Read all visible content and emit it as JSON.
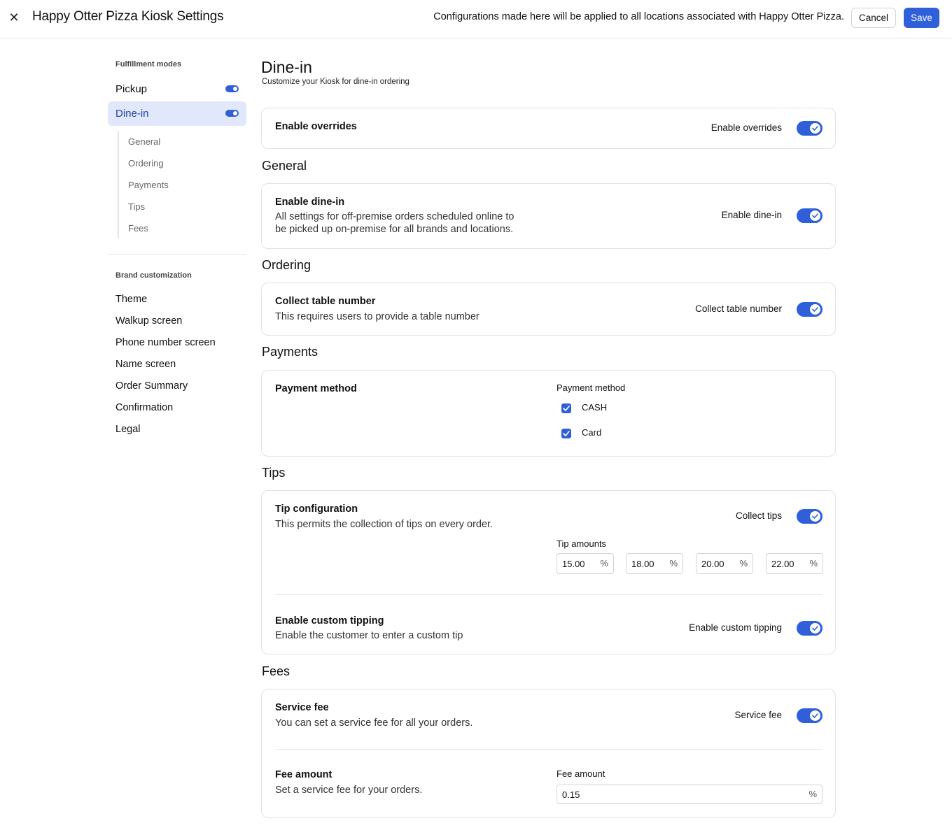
{
  "header": {
    "close_icon": "close-icon",
    "title": "Happy Otter Pizza Kiosk Settings",
    "note": "Configurations made here will be applied to all locations associated with Happy Otter Pizza.",
    "cancel_label": "Cancel",
    "save_label": "Save"
  },
  "sidebar": {
    "fulfillment_label": "Fulfillment modes",
    "modes": [
      {
        "label": "Pickup",
        "enabled": true
      },
      {
        "label": "Dine-in",
        "enabled": true,
        "active": true
      }
    ],
    "sub_items": [
      "General",
      "Ordering",
      "Payments",
      "Tips",
      "Fees"
    ],
    "brand_label": "Brand customization",
    "brand_items": [
      "Theme",
      "Walkup screen",
      "Phone number screen",
      "Name screen",
      "Order Summary",
      "Confirmation",
      "Legal"
    ]
  },
  "main": {
    "title": "Dine-in",
    "subtitle": "Customize your Kiosk for dine-in ordering",
    "overrides": {
      "title": "Enable overrides",
      "toggle_label": "Enable overrides",
      "enabled": true
    },
    "general": {
      "section_title": "General",
      "title": "Enable dine-in",
      "desc_line1": "All settings for off-premise orders scheduled online to",
      "desc_line2": "be picked up on-premise for all brands and locations.",
      "toggle_label": "Enable dine-in",
      "enabled": true
    },
    "ordering": {
      "section_title": "Ordering",
      "title": "Collect table number",
      "desc": "This requires users to provide a table number",
      "toggle_label": "Collect table number",
      "enabled": true
    },
    "payments": {
      "section_title": "Payments",
      "title": "Payment method",
      "field_label": "Payment method",
      "options": [
        {
          "label": "CASH",
          "checked": true
        },
        {
          "label": "Card",
          "checked": true
        }
      ]
    },
    "tips": {
      "section_title": "Tips",
      "title": "Tip configuration",
      "desc": "This permits the collection of tips on every order.",
      "toggle_label": "Collect tips",
      "enabled": true,
      "amounts_label": "Tip amounts",
      "amounts": [
        "15.00",
        "18.00",
        "20.00",
        "22.00"
      ],
      "suffix": "%",
      "custom_title": "Enable custom tipping",
      "custom_desc": "Enable the customer to enter a custom tip",
      "custom_toggle_label": "Enable custom tipping",
      "custom_enabled": true
    },
    "fees": {
      "section_title": "Fees",
      "title": "Service fee",
      "desc": "You can set a service fee for all your orders.",
      "toggle_label": "Service fee",
      "enabled": true,
      "amount_title": "Fee amount",
      "amount_desc": "Set a service fee for your orders.",
      "amount_label": "Fee amount",
      "amount_value": "0.15",
      "suffix": "%"
    }
  },
  "colors": {
    "accent": "#2f5fd9",
    "active_bg": "#e1e8fb",
    "active_text": "#2442a8"
  }
}
